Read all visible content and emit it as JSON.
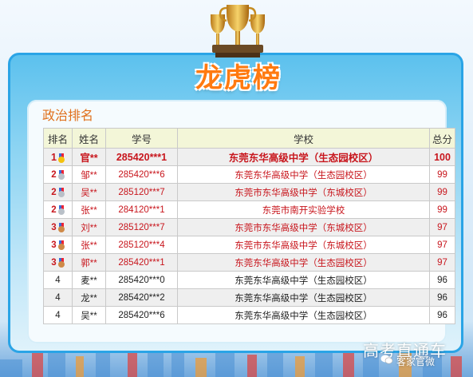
{
  "banner": {
    "title": "龙虎榜"
  },
  "section": {
    "subject": "政治排名"
  },
  "table": {
    "headers": [
      "排名",
      "姓名",
      "学号",
      "学校",
      "总分"
    ],
    "rows": [
      {
        "rank": "1",
        "medal": "gold",
        "name": "官**",
        "id": "285420***1",
        "school": "东莞东华高级中学（生态园校区）",
        "score": "100",
        "style": "gold"
      },
      {
        "rank": "2",
        "medal": "silver",
        "name": "邹**",
        "id": "285420***6",
        "school": "东莞东华高级中学（生态园校区）",
        "score": "99",
        "style": "hl"
      },
      {
        "rank": "2",
        "medal": "silver",
        "name": "吴**",
        "id": "285120***7",
        "school": "东莞市东华高级中学（东城校区）",
        "score": "99",
        "style": "hl"
      },
      {
        "rank": "2",
        "medal": "silver",
        "name": "张**",
        "id": "284120***1",
        "school": "东莞市南开实验学校",
        "score": "99",
        "style": "hl"
      },
      {
        "rank": "3",
        "medal": "bronze",
        "name": "刘**",
        "id": "285120***7",
        "school": "东莞市东华高级中学（东城校区）",
        "score": "97",
        "style": "hl"
      },
      {
        "rank": "3",
        "medal": "bronze",
        "name": "张**",
        "id": "285120***4",
        "school": "东莞市东华高级中学（东城校区）",
        "score": "97",
        "style": "hl"
      },
      {
        "rank": "3",
        "medal": "bronze",
        "name": "郭**",
        "id": "285420***1",
        "school": "东莞东华高级中学（生态园校区）",
        "score": "97",
        "style": "hl"
      },
      {
        "rank": "4",
        "medal": "",
        "name": "麦**",
        "id": "285420***0",
        "school": "东莞东华高级中学（生态园校区）",
        "score": "96",
        "style": "norm"
      },
      {
        "rank": "4",
        "medal": "",
        "name": "龙**",
        "id": "285420***2",
        "school": "东莞东华高级中学（生态园校区）",
        "score": "96",
        "style": "norm"
      },
      {
        "rank": "4",
        "medal": "",
        "name": "吴**",
        "id": "285420***6",
        "school": "东莞东华高级中学（生态园校区）",
        "score": "96",
        "style": "norm"
      }
    ]
  },
  "watermark": {
    "text": "高考直通车",
    "account": "客家官微"
  },
  "colors": {
    "title": "#ff7a10",
    "highlight": "#c8161d",
    "frame": "#2aa4e6",
    "header_bg": "#f3f6d8"
  }
}
